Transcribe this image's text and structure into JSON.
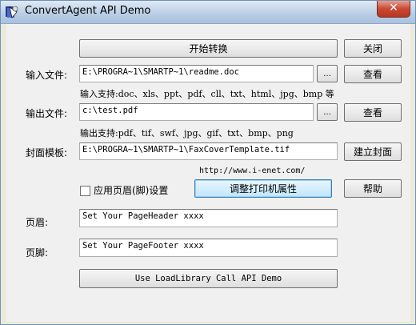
{
  "window": {
    "title": "ConvertAgent API Demo",
    "close_glyph": "✕"
  },
  "buttons": {
    "start": "开始转换",
    "close": "关闭",
    "view_input": "查看",
    "view_output": "查看",
    "browse_input": "...",
    "browse_output": "...",
    "build_cover": "建立封面",
    "printer_props": "调整打印机属性",
    "help": "帮助",
    "loadlib": "Use LoadLibrary Call API Demo"
  },
  "labels": {
    "input_file": "输入文件:",
    "output_file": "输出文件:",
    "cover_template": "封面模板:",
    "header": "页眉:",
    "footer": "页脚:",
    "apply_header": "应用页眉(脚)设置"
  },
  "hints": {
    "input_support": "输入支持:doc、xls、ppt、pdf、cll、txt、html、jpg、bmp 等",
    "output_support": "输出支持:pdf、tif、swf、jpg、gif、txt、bmp、png",
    "url": "http://www.i-enet.com/"
  },
  "fields": {
    "input_path": "E:\\PROGRA~1\\SMARTP~1\\readme.doc",
    "output_path": "c:\\test.pdf",
    "cover_path": "E:\\PROGRA~1\\SMARTP~1\\FaxCoverTemplate.tif",
    "header_text": "Set Your PageHeader xxxx",
    "footer_text": "Set Your PageFooter xxxx"
  },
  "apply_header_checked": false,
  "icons": {
    "app": "app-icon"
  }
}
